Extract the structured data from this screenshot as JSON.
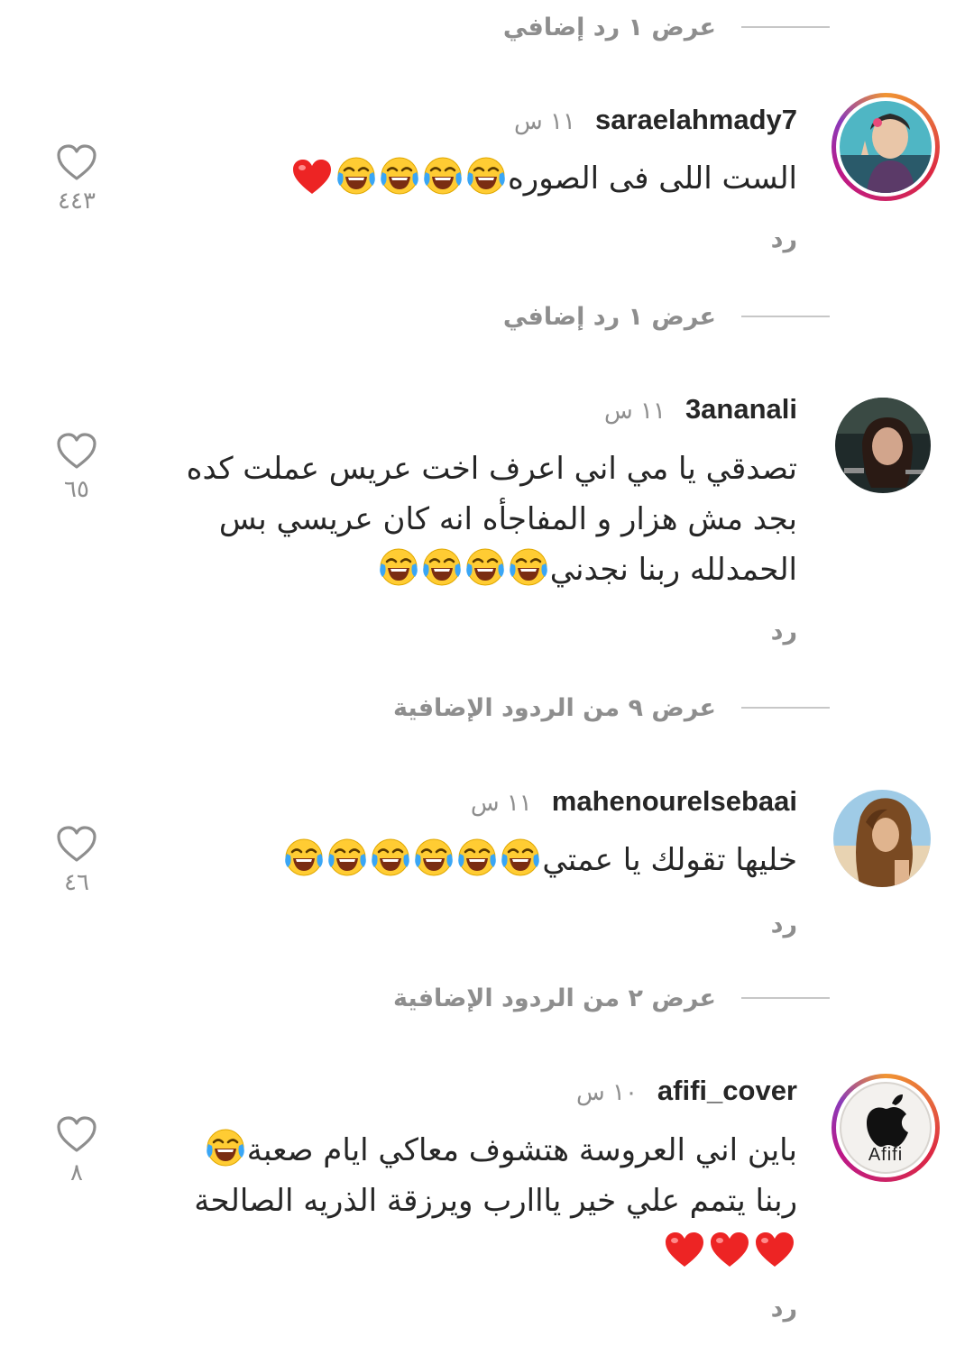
{
  "view_more": {
    "v1": "عرض ١ رد إضافي",
    "v2": "عرض ١ رد إضافي",
    "v3": "عرض ٩ من الردود الإضافية",
    "v4": "عرض ٢ من الردود الإضافية"
  },
  "reply_label": "رد",
  "comments": [
    {
      "username": "saraelahmady7",
      "time": "١١ س",
      "lines": [
        "الست اللى فى الصوره"
      ],
      "emoji_tail": "😂😂😂😂❤️",
      "likes": "٤٤٣"
    },
    {
      "username": "3ananali",
      "time": "١١ س",
      "lines": [
        "تصدقي يا مي اني اعرف اخت عريس عملت كده",
        "بجد مش هزار و المفاجأه انه كان عريسي بس",
        "الحمدلله ربنا نجدني"
      ],
      "emoji_tail": "😂😂😂😂",
      "likes": "٦٥"
    },
    {
      "username": "mahenourelsebaai",
      "time": "١١ س",
      "lines": [
        "خليها تقولك يا عمتي"
      ],
      "emoji_tail": "😂😂😂😂😂😂",
      "likes": "٤٦"
    },
    {
      "username": "afifi_cover",
      "time": "١٠ س",
      "lines": [
        "باين  اني العروسة هتشوف معاكي ايام صعبة",
        "ربنا يتمم علي خير يااارب ويرزقة الذريه الصالحة"
      ],
      "emoji_tail": "😂❤️❤️❤️",
      "likes": "٨",
      "avatar_label": "Afifi"
    }
  ],
  "colors": {
    "username": "#262626",
    "secondary": "#8e8e8e",
    "divider": "#c7c7c7",
    "heart_red": "#ed2424",
    "emoji_yellow": "#ffcc33"
  }
}
